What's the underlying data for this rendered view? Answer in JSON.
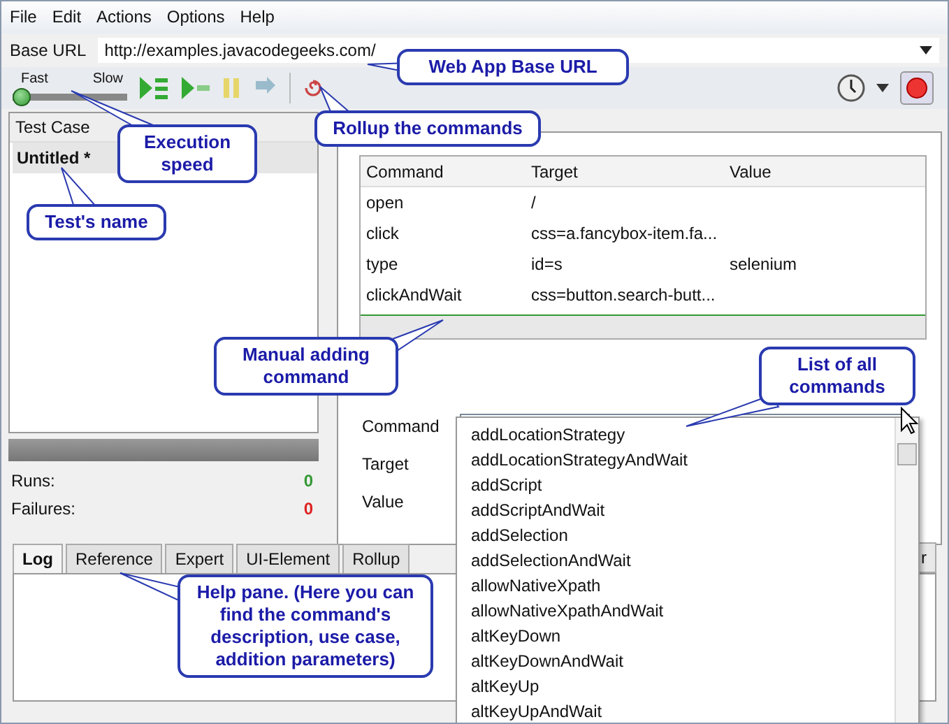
{
  "menu": [
    {
      "label": "File"
    },
    {
      "label": "Edit"
    },
    {
      "label": "Actions"
    },
    {
      "label": "Options"
    },
    {
      "label": "Help"
    }
  ],
  "base_url": {
    "label": "Base URL",
    "value": "http://examples.javacodegeeks.com/"
  },
  "speed": {
    "fast_label": "Fast",
    "slow_label": "Slow",
    "level": 0
  },
  "test_case": {
    "header": "Test Case",
    "items": [
      {
        "name": "Untitled *",
        "selected": true
      }
    ]
  },
  "progress": {
    "level": 0
  },
  "counters": {
    "runs": {
      "label": "Runs:",
      "value": "0"
    },
    "failures": {
      "label": "Failures:",
      "value": "0"
    }
  },
  "table": {
    "columns": [
      "Command",
      "Target",
      "Value"
    ],
    "rows": [
      [
        "open",
        "/",
        ""
      ],
      [
        "click",
        "css=a.fancybox-item.fa...",
        ""
      ],
      [
        "type",
        "id=s",
        "selenium"
      ],
      [
        "clickAndWait",
        "css=button.search-butt...",
        ""
      ]
    ]
  },
  "form": {
    "fields": [
      {
        "label": "Command"
      },
      {
        "label": "Target"
      },
      {
        "label": "Value"
      }
    ]
  },
  "dropdown": {
    "items": [
      "addLocationStrategy",
      "addLocationStrategyAndWait",
      "addScript",
      "addScriptAndWait",
      "addSelection",
      "addSelectionAndWait",
      "allowNativeXpath",
      "allowNativeXpathAndWait",
      "altKeyDown",
      "altKeyDownAndWait",
      "altKeyUp",
      "altKeyUpAndWait"
    ]
  },
  "bottom_tabs": [
    {
      "label": "Log",
      "selected": true
    },
    {
      "label": "Reference",
      "selected": false
    },
    {
      "label": "Expert",
      "selected": false
    },
    {
      "label": "UI-Element",
      "selected": false
    },
    {
      "label": "Rollup",
      "selected": false
    }
  ],
  "clear_button": {
    "label": "r"
  },
  "callouts": [
    {
      "text": "Web App Base URL"
    },
    {
      "text": "Execution speed"
    },
    {
      "text": "Rollup the commands"
    },
    {
      "text": "Test's name"
    },
    {
      "text": "Manual adding command"
    },
    {
      "text": "List of all commands"
    },
    {
      "text": "Help pane. (Here you can find the command's description, use case, addition parameters)"
    }
  ]
}
